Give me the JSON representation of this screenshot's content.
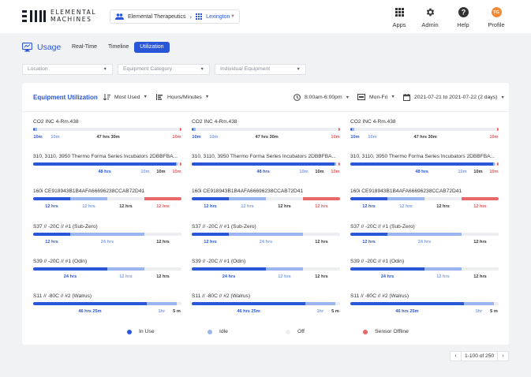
{
  "brand": {
    "line1": "ELEMENTAL",
    "line2": "MACHINES"
  },
  "breadcrumb": {
    "org": "Elemental Therapeutics",
    "location": "Lexington"
  },
  "nav": [
    {
      "label": "Apps",
      "icon": "apps-grid-icon"
    },
    {
      "label": "Admin",
      "icon": "gear-icon"
    },
    {
      "label": "Help",
      "icon": "help-icon"
    },
    {
      "label": "Profile",
      "icon": "avatar",
      "initials": "TG"
    }
  ],
  "usage": {
    "title": "Usage",
    "tabs": [
      {
        "label": "Real-Time",
        "active": false
      },
      {
        "label": "Timeline",
        "active": false
      },
      {
        "label": "Utilization",
        "active": true
      }
    ]
  },
  "filters": {
    "location": "Location",
    "category": "Equipment Category",
    "equipment": "Individual Equipment"
  },
  "card": {
    "title": "Equipment Utilization",
    "sort": "Most Used",
    "units": "Hours/Minutes",
    "time_range": "8:00am-6:00pm",
    "days": "Mon-Fri",
    "date_range": "2021-07-21 to 2021-07-22 (2 days)"
  },
  "colors": {
    "in_use": "#2a56d8",
    "idle": "#9ab5f0",
    "off": "#eceef1",
    "offline": "#e8686a"
  },
  "equipment": [
    {
      "name": "CO2 INC 4-Rm.438",
      "segments": [
        {
          "state": "in_use",
          "fraction": 0.012,
          "label": "10m"
        },
        {
          "state": "idle",
          "fraction": 0.012,
          "label": "10m"
        },
        {
          "state": "off",
          "fraction": 0.964,
          "label": "47 hrs 30m"
        },
        {
          "state": "offline",
          "fraction": 0.012,
          "label": "10m"
        }
      ]
    },
    {
      "name": "310, 3110, 3950 Thermo Forma Series Incubators 2DBBFBA...",
      "segments": [
        {
          "state": "in_use",
          "fraction": 0.964,
          "label": "48 hrs"
        },
        {
          "state": "idle",
          "fraction": 0.012,
          "label": "10m"
        },
        {
          "state": "off",
          "fraction": 0.012,
          "label": "10m"
        },
        {
          "state": "offline",
          "fraction": 0.012,
          "label": "10m"
        }
      ]
    },
    {
      "name": "160i CE918943B1B4AFA66696238CCAB72D41",
      "segments": [
        {
          "state": "in_use",
          "fraction": 0.25,
          "label": "12 hrs"
        },
        {
          "state": "idle",
          "fraction": 0.25,
          "label": "12 hrs"
        },
        {
          "state": "off",
          "fraction": 0.25,
          "label": "12 hrs"
        },
        {
          "state": "offline",
          "fraction": 0.25,
          "label": "12 hrs"
        }
      ]
    },
    {
      "name": "S37 // -20C // #1 (Sub-Zero)",
      "segments": [
        {
          "state": "in_use",
          "fraction": 0.25,
          "label": "12 hrs"
        },
        {
          "state": "idle",
          "fraction": 0.5,
          "label": "24 hrs"
        },
        {
          "state": "off",
          "fraction": 0.25,
          "label": "12 hrs"
        }
      ]
    },
    {
      "name": "S39 // -20C // #1 (Odin)",
      "segments": [
        {
          "state": "in_use",
          "fraction": 0.5,
          "label": "24 hrs"
        },
        {
          "state": "idle",
          "fraction": 0.25,
          "label": "12 hrs"
        },
        {
          "state": "off",
          "fraction": 0.25,
          "label": "12 hrs"
        }
      ]
    },
    {
      "name": "S11 // -80C // #2 (Walrus)",
      "segments": [
        {
          "state": "in_use",
          "fraction": 0.766,
          "label": "46 hrs 25m"
        },
        {
          "state": "idle",
          "fraction": 0.2,
          "label": "1hr"
        },
        {
          "state": "off",
          "fraction": 0.034,
          "label": "5 m"
        }
      ]
    }
  ],
  "legend": [
    {
      "label": "In Use",
      "state": "in_use"
    },
    {
      "label": "Idle",
      "state": "idle"
    },
    {
      "label": "Off",
      "state": "off"
    },
    {
      "label": "Sensor Offline",
      "state": "offline"
    }
  ],
  "pagination": {
    "range": "1-100 of 250"
  }
}
